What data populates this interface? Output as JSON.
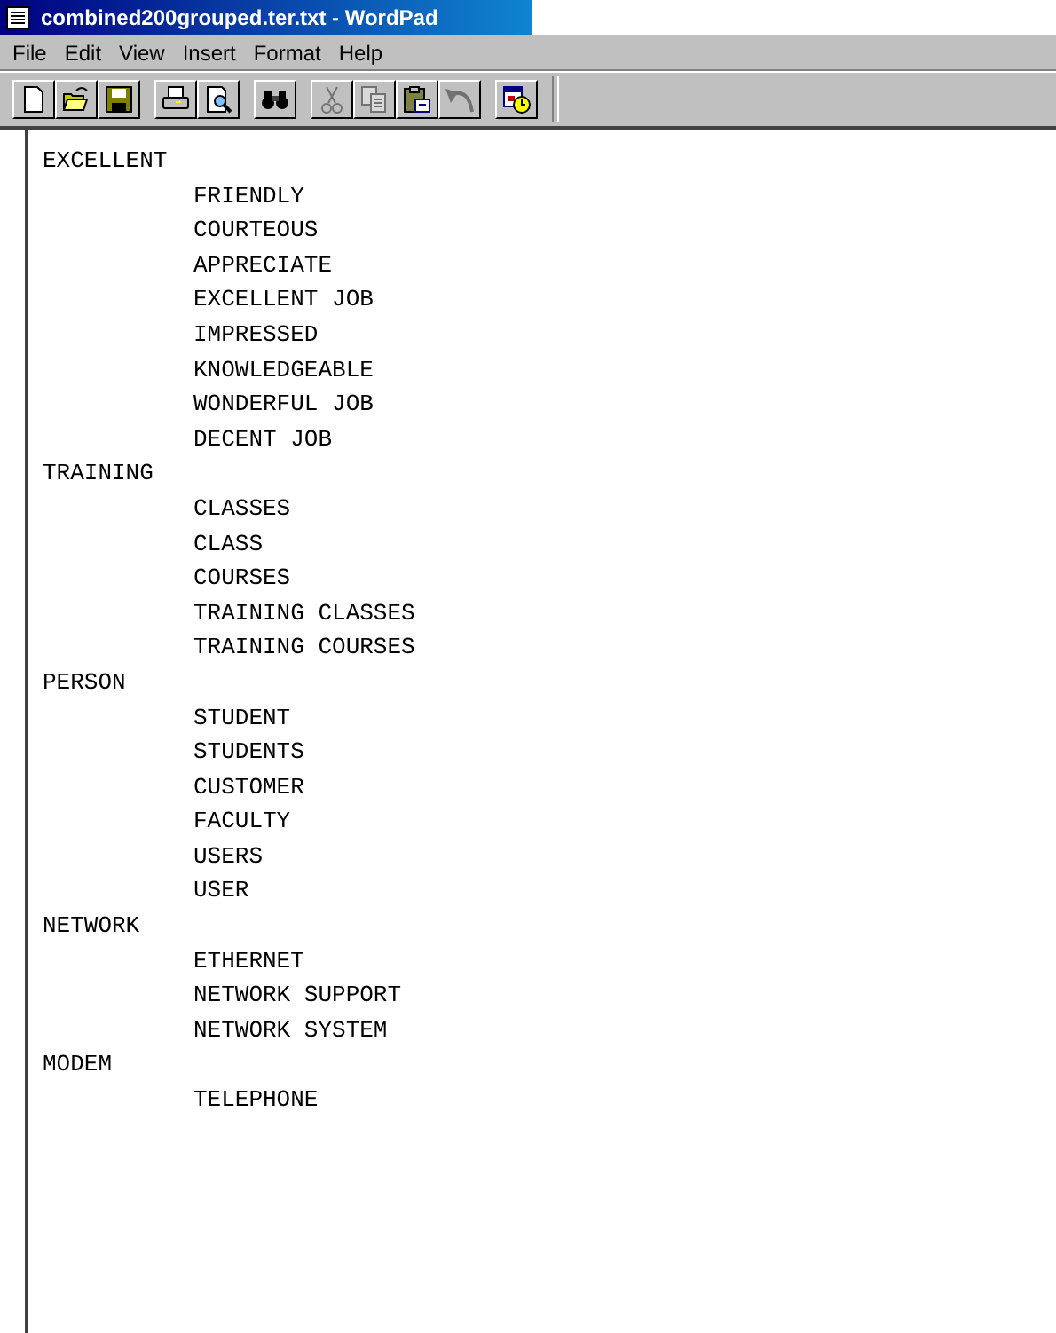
{
  "window": {
    "title": "combined200grouped.ter.txt - WordPad"
  },
  "menu": [
    "File",
    "Edit",
    "View",
    "Insert",
    "Format",
    "Help"
  ],
  "toolbar": [
    [
      {
        "kind": "new",
        "disabled": false
      },
      {
        "kind": "open",
        "disabled": false
      },
      {
        "kind": "save",
        "disabled": false
      }
    ],
    [
      {
        "kind": "print",
        "disabled": false
      },
      {
        "kind": "preview",
        "disabled": false
      }
    ],
    [
      {
        "kind": "find",
        "disabled": false
      }
    ],
    [
      {
        "kind": "cut",
        "disabled": true
      },
      {
        "kind": "copy",
        "disabled": true
      },
      {
        "kind": "paste",
        "disabled": false
      },
      {
        "kind": "undo",
        "disabled": true
      }
    ],
    [
      {
        "kind": "datetime",
        "disabled": false
      }
    ]
  ],
  "document": [
    {
      "text": "EXCELLENT",
      "children": [
        {
          "text": "FRIENDLY"
        },
        {
          "text": "COURTEOUS"
        },
        {
          "text": "APPRECIATE"
        },
        {
          "text": "EXCELLENT JOB"
        },
        {
          "text": "IMPRESSED"
        },
        {
          "text": "KNOWLEDGEABLE"
        },
        {
          "text": "WONDERFUL JOB"
        },
        {
          "text": "DECENT JOB"
        }
      ]
    },
    {
      "text": "TRAINING",
      "children": [
        {
          "text": "CLASSES"
        },
        {
          "text": "CLASS"
        },
        {
          "text": "COURSES"
        },
        {
          "text": "TRAINING CLASSES"
        },
        {
          "text": "TRAINING COURSES"
        }
      ]
    },
    {
      "text": "PERSON",
      "children": [
        {
          "text": "STUDENT"
        },
        {
          "text": "STUDENTS"
        },
        {
          "text": "CUSTOMER"
        },
        {
          "text": "FACULTY"
        },
        {
          "text": "USERS"
        },
        {
          "text": "USER"
        }
      ]
    },
    {
      "text": "NETWORK",
      "children": [
        {
          "text": "ETHERNET"
        },
        {
          "text": "NETWORK SUPPORT"
        },
        {
          "text": "NETWORK SYSTEM"
        }
      ]
    },
    {
      "text": "MODEM",
      "children": [
        {
          "text": "TELEPHONE"
        }
      ]
    }
  ]
}
